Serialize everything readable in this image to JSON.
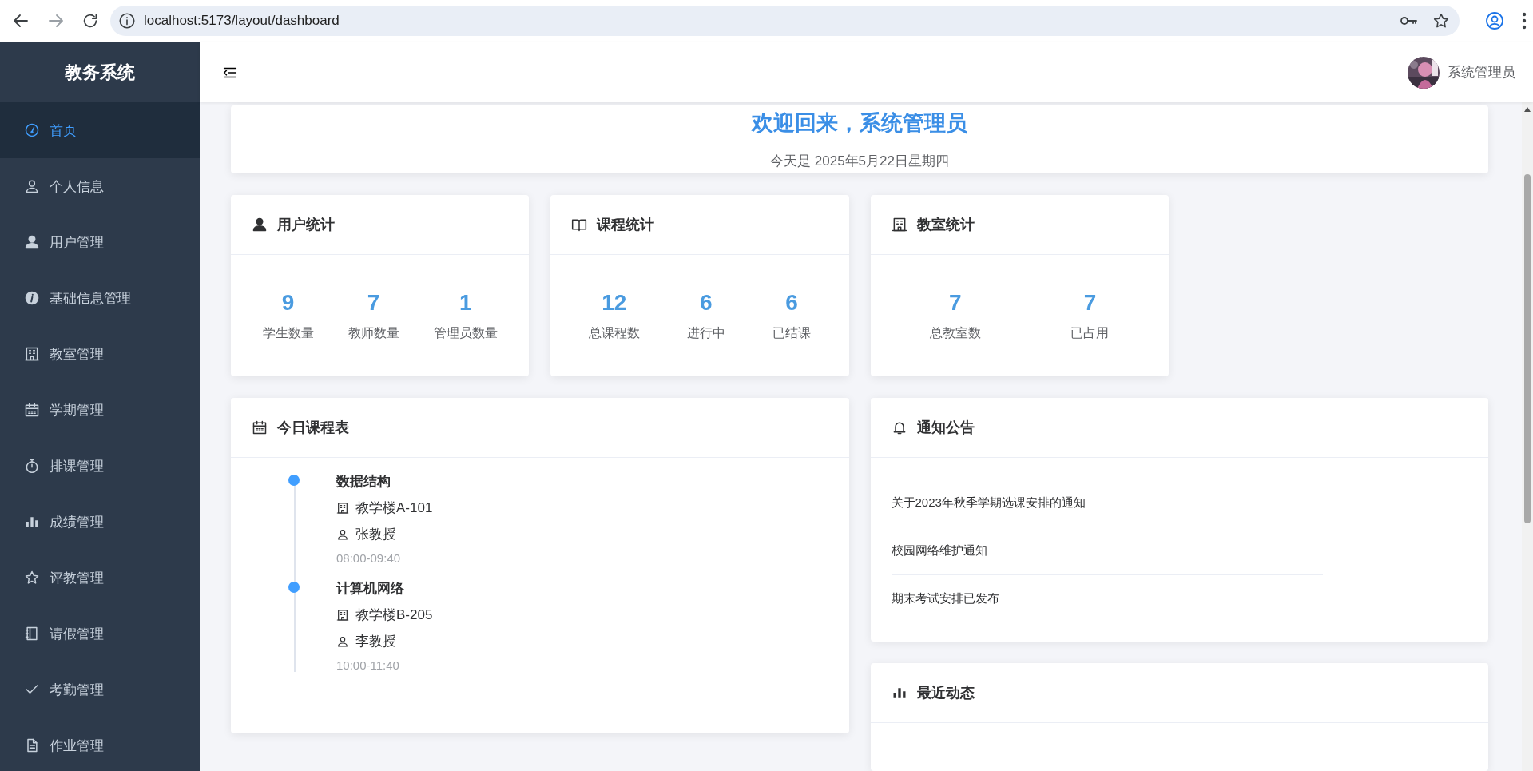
{
  "browser": {
    "url": "localhost:5173/layout/dashboard"
  },
  "sidebar": {
    "logo": "教务系统",
    "items": [
      {
        "label": "首页",
        "selected": true
      },
      {
        "label": "个人信息",
        "selected": false
      },
      {
        "label": "用户管理",
        "selected": false
      },
      {
        "label": "基础信息管理",
        "selected": false
      },
      {
        "label": "教室管理",
        "selected": false
      },
      {
        "label": "学期管理",
        "selected": false
      },
      {
        "label": "排课管理",
        "selected": false
      },
      {
        "label": "成绩管理",
        "selected": false
      },
      {
        "label": "评教管理",
        "selected": false
      },
      {
        "label": "请假管理",
        "selected": false
      },
      {
        "label": "考勤管理",
        "selected": false
      },
      {
        "label": "作业管理",
        "selected": false
      }
    ]
  },
  "header": {
    "user_name": "系统管理员"
  },
  "welcome": {
    "title": "欢迎回来，系统管理员",
    "date": "今天是 2025年5月22日星期四"
  },
  "stat_cards": [
    {
      "title": "用户统计",
      "stats": [
        {
          "value": "9",
          "label": "学生数量"
        },
        {
          "value": "7",
          "label": "教师数量"
        },
        {
          "value": "1",
          "label": "管理员数量"
        }
      ]
    },
    {
      "title": "课程统计",
      "stats": [
        {
          "value": "12",
          "label": "总课程数"
        },
        {
          "value": "6",
          "label": "进行中"
        },
        {
          "value": "6",
          "label": "已结课"
        }
      ]
    },
    {
      "title": "教室统计",
      "stats": [
        {
          "value": "7",
          "label": "总教室数"
        },
        {
          "value": "7",
          "label": "已占用"
        }
      ]
    }
  ],
  "schedule": {
    "title": "今日课程表",
    "courses": [
      {
        "name": "数据结构",
        "location": "教学楼A-101",
        "teacher": "张教授",
        "time": "08:00-09:40"
      },
      {
        "name": "计算机网络",
        "location": "教学楼B-205",
        "teacher": "李教授",
        "time": "10:00-11:40"
      }
    ]
  },
  "notices": {
    "title": "通知公告",
    "items": [
      "关于2023年秋季学期选课安排的通知",
      "校园网络维护通知",
      "期末考试安排已发布"
    ]
  },
  "recent": {
    "title": "最近动态"
  }
}
